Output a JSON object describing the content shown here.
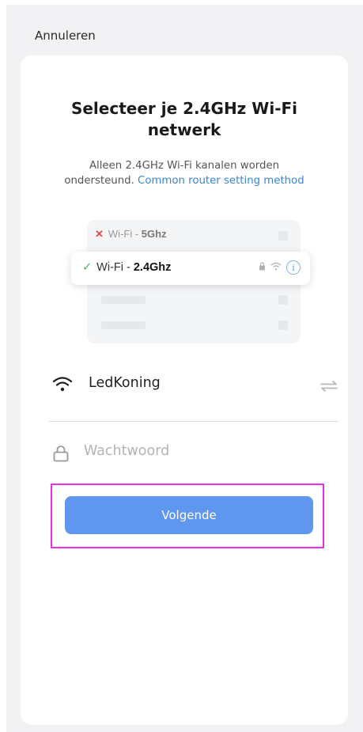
{
  "header": {
    "cancel_label": "Annuleren"
  },
  "main": {
    "title_line1": "Selecteer je 2.4GHz Wi-Fi",
    "title_line2": "netwerk",
    "subtitle_line1": "Alleen 2.4GHz Wi-Fi kanalen worden",
    "subtitle_line2_text": "ondersteund.",
    "subtitle_link": "Common router setting method"
  },
  "illustration": {
    "row_5g": {
      "prefix": "Wi-Fi - ",
      "band": "5Ghz"
    },
    "row_24": {
      "prefix": "Wi-Fi - ",
      "band": "2.4Ghz"
    }
  },
  "form": {
    "ssid_value": "LedKoning",
    "password_placeholder": "Wachtwoord",
    "next_label": "Volgende"
  },
  "colors": {
    "accent": "#5f97f0",
    "link": "#3a84d0",
    "highlight": "#ee2ee6",
    "error": "#e14b4b",
    "success": "#3cb371"
  },
  "icons": [
    "wifi-icon",
    "swap-icon",
    "lock-icon",
    "check-icon",
    "cross-icon",
    "info-icon"
  ]
}
